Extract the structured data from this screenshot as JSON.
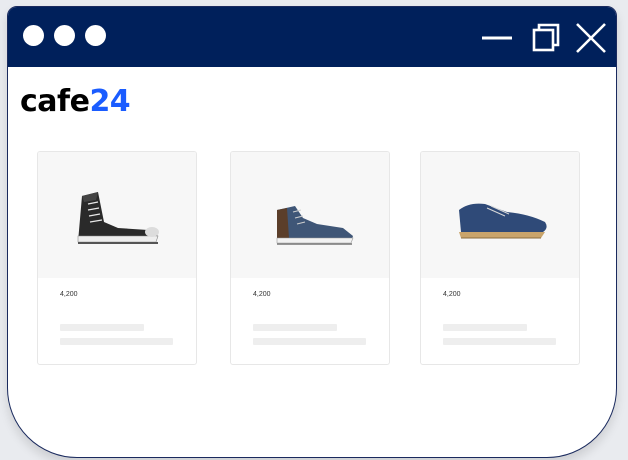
{
  "window": {
    "title_bar_color": "#00205b",
    "controls": [
      "minimize-icon",
      "maximize-icon",
      "close-icon"
    ]
  },
  "brand": {
    "logo_part1": "cafe",
    "logo_part2": "24",
    "logo_color_dark": "#000000",
    "logo_color_accent": "#1a5cff"
  },
  "products": [
    {
      "image": "black-high-top-sneaker",
      "price": "4,200"
    },
    {
      "image": "blue-high-top-sneaker",
      "price": "4,200"
    },
    {
      "image": "blue-low-top-shoe",
      "price": "4,200"
    }
  ]
}
